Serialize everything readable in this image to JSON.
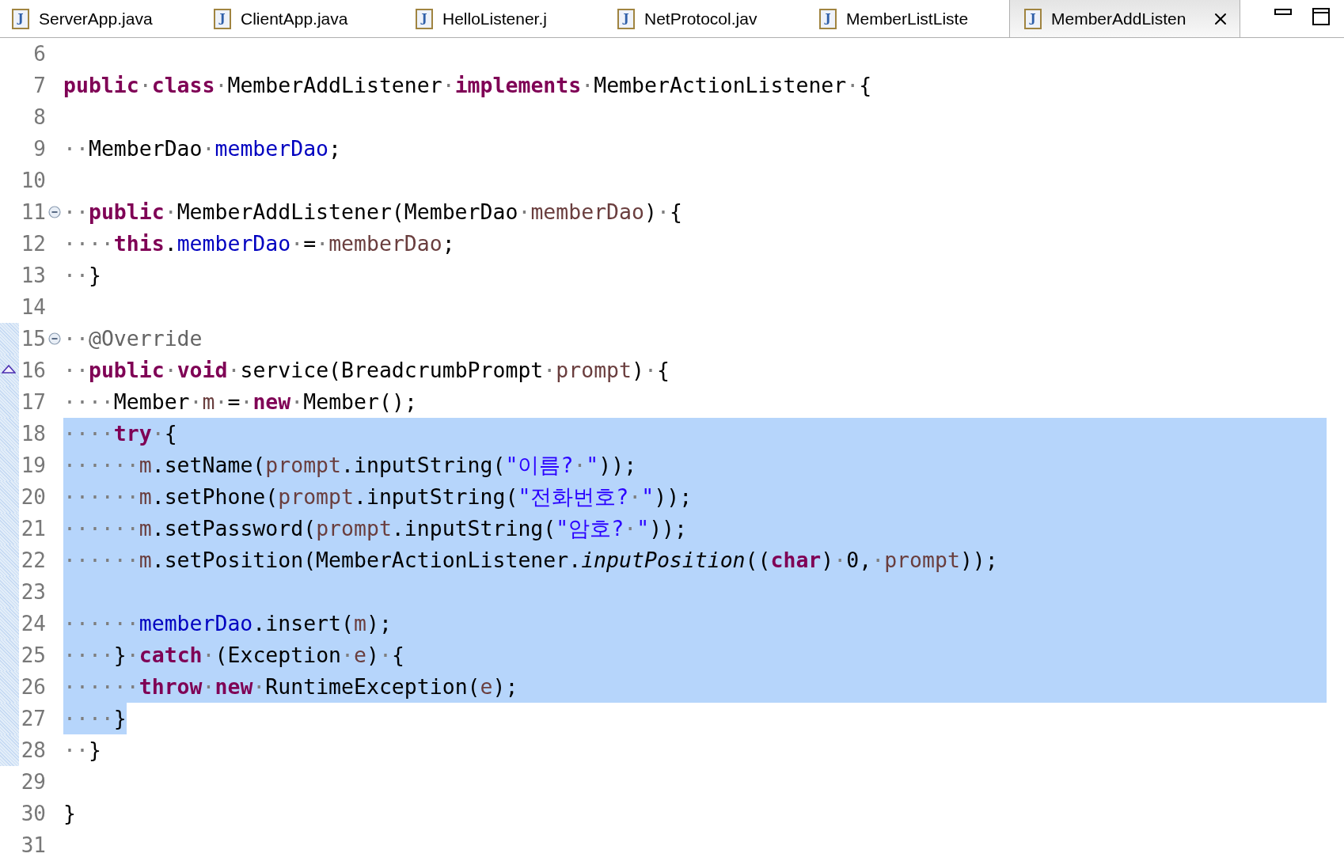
{
  "tabs": [
    {
      "icon_letter": "J",
      "label": "ServerApp.java",
      "selected": false
    },
    {
      "icon_letter": "J",
      "label": "ClientApp.java",
      "selected": false
    },
    {
      "icon_letter": "J",
      "label": "HelloListener.j",
      "selected": false
    },
    {
      "icon_letter": "J",
      "label": "NetProtocol.jav",
      "selected": false
    },
    {
      "icon_letter": "J",
      "label": "MemberListListe",
      "selected": false
    },
    {
      "icon_letter": "J",
      "label": "MemberAddListen",
      "selected": true
    }
  ],
  "lines": [
    {
      "number": "6",
      "fold": false,
      "override": false,
      "in_range": false,
      "selected": false
    },
    {
      "number": "7",
      "fold": false,
      "override": false,
      "in_range": false,
      "selected": false,
      "tokens": [
        {
          "kind": "kw",
          "text": "public"
        },
        {
          "kind": "ws",
          "text": "·"
        },
        {
          "kind": "kw",
          "text": "class"
        },
        {
          "kind": "ws",
          "text": "·"
        },
        {
          "kind": "plain",
          "text": "MemberAddListener"
        },
        {
          "kind": "ws",
          "text": "·"
        },
        {
          "kind": "kw",
          "text": "implements"
        },
        {
          "kind": "ws",
          "text": "·"
        },
        {
          "kind": "plain",
          "text": "MemberActionListener"
        },
        {
          "kind": "ws",
          "text": "·"
        },
        {
          "kind": "plain",
          "text": "{"
        }
      ]
    },
    {
      "number": "8",
      "fold": false,
      "override": false,
      "in_range": false,
      "selected": false
    },
    {
      "number": "9",
      "fold": false,
      "override": false,
      "in_range": false,
      "selected": false,
      "tokens": [
        {
          "kind": "ws",
          "text": "··"
        },
        {
          "kind": "plain",
          "text": "MemberDao"
        },
        {
          "kind": "ws",
          "text": "·"
        },
        {
          "kind": "field",
          "text": "memberDao"
        },
        {
          "kind": "plain",
          "text": ";"
        }
      ]
    },
    {
      "number": "10",
      "fold": false,
      "override": false,
      "in_range": false,
      "selected": false
    },
    {
      "number": "11",
      "fold": true,
      "override": false,
      "in_range": false,
      "selected": false,
      "tokens": [
        {
          "kind": "ws",
          "text": "··"
        },
        {
          "kind": "kw",
          "text": "public"
        },
        {
          "kind": "ws",
          "text": "·"
        },
        {
          "kind": "plain",
          "text": "MemberAddListener(MemberDao"
        },
        {
          "kind": "ws",
          "text": "·"
        },
        {
          "kind": "param",
          "text": "memberDao"
        },
        {
          "kind": "plain",
          "text": ")"
        },
        {
          "kind": "ws",
          "text": "·"
        },
        {
          "kind": "plain",
          "text": "{"
        }
      ]
    },
    {
      "number": "12",
      "fold": false,
      "override": false,
      "in_range": false,
      "selected": false,
      "tokens": [
        {
          "kind": "ws",
          "text": "····"
        },
        {
          "kind": "kw",
          "text": "this"
        },
        {
          "kind": "plain",
          "text": "."
        },
        {
          "kind": "field",
          "text": "memberDao"
        },
        {
          "kind": "ws",
          "text": "·"
        },
        {
          "kind": "plain",
          "text": "="
        },
        {
          "kind": "ws",
          "text": "·"
        },
        {
          "kind": "param",
          "text": "memberDao"
        },
        {
          "kind": "plain",
          "text": ";"
        }
      ]
    },
    {
      "number": "13",
      "fold": false,
      "override": false,
      "in_range": false,
      "selected": false,
      "tokens": [
        {
          "kind": "ws",
          "text": "··"
        },
        {
          "kind": "plain",
          "text": "}"
        }
      ]
    },
    {
      "number": "14",
      "fold": false,
      "override": false,
      "in_range": false,
      "selected": false
    },
    {
      "number": "15",
      "fold": true,
      "override": false,
      "in_range": true,
      "selected": false,
      "tokens": [
        {
          "kind": "ws",
          "text": "··"
        },
        {
          "kind": "ann",
          "text": "@Override"
        }
      ]
    },
    {
      "number": "16",
      "fold": false,
      "override": true,
      "in_range": true,
      "selected": false,
      "tokens": [
        {
          "kind": "ws",
          "text": "··"
        },
        {
          "kind": "kw",
          "text": "public"
        },
        {
          "kind": "ws",
          "text": "·"
        },
        {
          "kind": "kw",
          "text": "void"
        },
        {
          "kind": "ws",
          "text": "·"
        },
        {
          "kind": "plain",
          "text": "service(BreadcrumbPrompt"
        },
        {
          "kind": "ws",
          "text": "·"
        },
        {
          "kind": "param",
          "text": "prompt"
        },
        {
          "kind": "plain",
          "text": ")"
        },
        {
          "kind": "ws",
          "text": "·"
        },
        {
          "kind": "plain",
          "text": "{"
        }
      ]
    },
    {
      "number": "17",
      "fold": false,
      "override": false,
      "in_range": true,
      "selected": false,
      "tokens": [
        {
          "kind": "ws",
          "text": "····"
        },
        {
          "kind": "plain",
          "text": "Member"
        },
        {
          "kind": "ws",
          "text": "·"
        },
        {
          "kind": "param",
          "text": "m"
        },
        {
          "kind": "ws",
          "text": "·"
        },
        {
          "kind": "plain",
          "text": "="
        },
        {
          "kind": "ws",
          "text": "·"
        },
        {
          "kind": "kw",
          "text": "new"
        },
        {
          "kind": "ws",
          "text": "·"
        },
        {
          "kind": "plain",
          "text": "Member();"
        }
      ]
    },
    {
      "number": "18",
      "fold": false,
      "override": false,
      "in_range": true,
      "selected": true,
      "tokens": [
        {
          "kind": "ws",
          "text": "····"
        },
        {
          "kind": "kw",
          "text": "try"
        },
        {
          "kind": "ws",
          "text": "·"
        },
        {
          "kind": "plain",
          "text": "{"
        }
      ]
    },
    {
      "number": "19",
      "fold": false,
      "override": false,
      "in_range": true,
      "selected": true,
      "tokens": [
        {
          "kind": "ws",
          "text": "······"
        },
        {
          "kind": "param",
          "text": "m"
        },
        {
          "kind": "plain",
          "text": ".setName("
        },
        {
          "kind": "param",
          "text": "prompt"
        },
        {
          "kind": "plain",
          "text": ".inputString("
        },
        {
          "kind": "str",
          "text": "\"이름?"
        },
        {
          "kind": "ws",
          "text": "·"
        },
        {
          "kind": "str",
          "text": "\""
        },
        {
          "kind": "plain",
          "text": "));"
        }
      ]
    },
    {
      "number": "20",
      "fold": false,
      "override": false,
      "in_range": true,
      "selected": true,
      "tokens": [
        {
          "kind": "ws",
          "text": "······"
        },
        {
          "kind": "param",
          "text": "m"
        },
        {
          "kind": "plain",
          "text": ".setPhone("
        },
        {
          "kind": "param",
          "text": "prompt"
        },
        {
          "kind": "plain",
          "text": ".inputString("
        },
        {
          "kind": "str",
          "text": "\"전화번호?"
        },
        {
          "kind": "ws",
          "text": "·"
        },
        {
          "kind": "str",
          "text": "\""
        },
        {
          "kind": "plain",
          "text": "));"
        }
      ]
    },
    {
      "number": "21",
      "fold": false,
      "override": false,
      "in_range": true,
      "selected": true,
      "tokens": [
        {
          "kind": "ws",
          "text": "······"
        },
        {
          "kind": "param",
          "text": "m"
        },
        {
          "kind": "plain",
          "text": ".setPassword("
        },
        {
          "kind": "param",
          "text": "prompt"
        },
        {
          "kind": "plain",
          "text": ".inputString("
        },
        {
          "kind": "str",
          "text": "\"암호?"
        },
        {
          "kind": "ws",
          "text": "·"
        },
        {
          "kind": "str",
          "text": "\""
        },
        {
          "kind": "plain",
          "text": "));"
        }
      ]
    },
    {
      "number": "22",
      "fold": false,
      "override": false,
      "in_range": true,
      "selected": true,
      "tokens": [
        {
          "kind": "ws",
          "text": "······"
        },
        {
          "kind": "param",
          "text": "m"
        },
        {
          "kind": "plain",
          "text": ".setPosition(MemberActionListener."
        },
        {
          "kind": "static",
          "text": "inputPosition"
        },
        {
          "kind": "plain",
          "text": "(("
        },
        {
          "kind": "kw",
          "text": "char"
        },
        {
          "kind": "plain",
          "text": ")"
        },
        {
          "kind": "ws",
          "text": "·"
        },
        {
          "kind": "plain",
          "text": "0,"
        },
        {
          "kind": "ws",
          "text": "·"
        },
        {
          "kind": "param",
          "text": "prompt"
        },
        {
          "kind": "plain",
          "text": "));"
        }
      ]
    },
    {
      "number": "23",
      "fold": false,
      "override": false,
      "in_range": true,
      "selected": true
    },
    {
      "number": "24",
      "fold": false,
      "override": false,
      "in_range": true,
      "selected": true,
      "tokens": [
        {
          "kind": "ws",
          "text": "······"
        },
        {
          "kind": "field",
          "text": "memberDao"
        },
        {
          "kind": "plain",
          "text": ".insert("
        },
        {
          "kind": "param",
          "text": "m"
        },
        {
          "kind": "plain",
          "text": ");"
        }
      ]
    },
    {
      "number": "25",
      "fold": false,
      "override": false,
      "in_range": true,
      "selected": true,
      "tokens": [
        {
          "kind": "ws",
          "text": "····"
        },
        {
          "kind": "plain",
          "text": "}"
        },
        {
          "kind": "ws",
          "text": "·"
        },
        {
          "kind": "kw",
          "text": "catch"
        },
        {
          "kind": "ws",
          "text": "·"
        },
        {
          "kind": "plain",
          "text": "(Exception"
        },
        {
          "kind": "ws",
          "text": "·"
        },
        {
          "kind": "param",
          "text": "e"
        },
        {
          "kind": "plain",
          "text": ")"
        },
        {
          "kind": "ws",
          "text": "·"
        },
        {
          "kind": "plain",
          "text": "{"
        }
      ]
    },
    {
      "number": "26",
      "fold": false,
      "override": false,
      "in_range": true,
      "selected": true,
      "tokens": [
        {
          "kind": "ws",
          "text": "······"
        },
        {
          "kind": "kw",
          "text": "throw"
        },
        {
          "kind": "ws",
          "text": "·"
        },
        {
          "kind": "kw",
          "text": "new"
        },
        {
          "kind": "ws",
          "text": "·"
        },
        {
          "kind": "plain",
          "text": "RuntimeException("
        },
        {
          "kind": "param",
          "text": "e"
        },
        {
          "kind": "plain",
          "text": ");"
        }
      ]
    },
    {
      "number": "27",
      "fold": false,
      "override": false,
      "in_range": true,
      "selected": true,
      "tokens": [
        {
          "kind": "ws",
          "text": "····"
        },
        {
          "kind": "plain",
          "text": "}"
        }
      ]
    },
    {
      "number": "28",
      "fold": false,
      "override": false,
      "in_range": true,
      "selected": false,
      "tokens": [
        {
          "kind": "ws",
          "text": "··"
        },
        {
          "kind": "plain",
          "text": "}"
        }
      ]
    },
    {
      "number": "29",
      "fold": false,
      "override": false,
      "in_range": false,
      "selected": false
    },
    {
      "number": "30",
      "fold": false,
      "override": false,
      "in_range": false,
      "selected": false,
      "tokens": [
        {
          "kind": "plain",
          "text": "}"
        }
      ]
    },
    {
      "number": "31",
      "fold": false,
      "override": false,
      "in_range": false,
      "selected": false
    }
  ]
}
